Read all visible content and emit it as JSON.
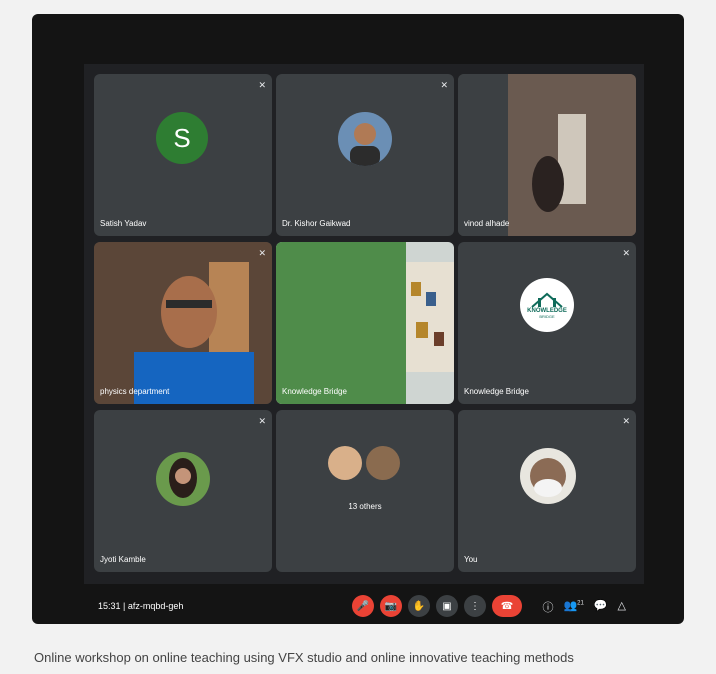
{
  "tiles": [
    {
      "name": "Satish Yadav",
      "initial": "S"
    },
    {
      "name": "Dr. Kishor Gaikwad"
    },
    {
      "name": "vinod alhade"
    },
    {
      "name": "physics department"
    },
    {
      "name": "Knowledge Bridge"
    },
    {
      "name": "Knowledge Bridge",
      "logo_line1": "KNOWLEDGE",
      "logo_line2": "BRIDGE"
    },
    {
      "name": "Jyoti Kamble"
    },
    {
      "label": "13 others"
    },
    {
      "name": "You"
    }
  ],
  "meeting": {
    "time": "15:31",
    "code": "afz-mqbd-geh",
    "participants_count": "21"
  },
  "caption": "Online workshop on online teaching using VFX studio and online innovative teaching methods",
  "colors": {
    "end_call": "#ea4335",
    "tile": "#3c4043",
    "avatar_s": "#2e7d32"
  }
}
